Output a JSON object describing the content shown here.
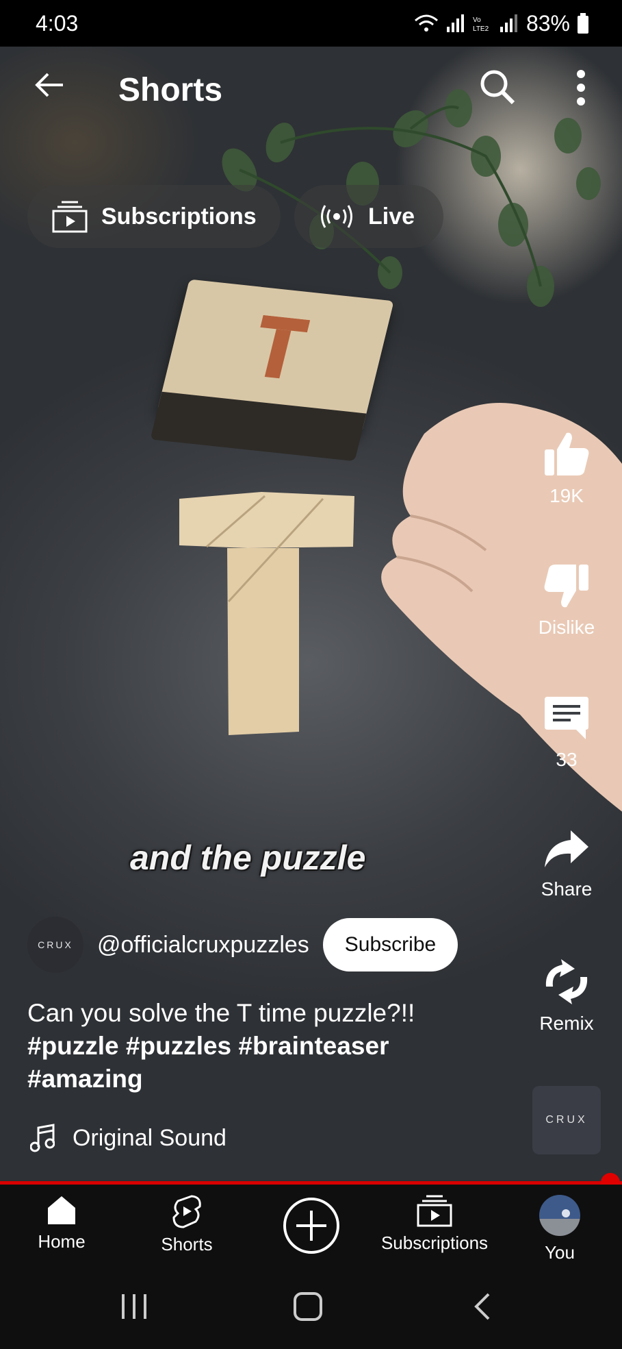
{
  "status_bar": {
    "time": "4:03",
    "battery": "83%"
  },
  "header": {
    "title": "Shorts"
  },
  "chips": [
    {
      "label": "Subscriptions"
    },
    {
      "label": "Live"
    }
  ],
  "video": {
    "caption": "and the puzzle"
  },
  "actions": {
    "like_count": "19K",
    "dislike_label": "Dislike",
    "comment_count": "33",
    "share_label": "Share",
    "remix_label": "Remix"
  },
  "channel": {
    "avatar_text": "CRUX",
    "handle": "@officialcruxpuzzles",
    "subscribe_label": "Subscribe"
  },
  "description": {
    "text": "Can you solve the T time puzzle?!!",
    "hashtags": "#puzzle #puzzles #brainteaser #amazing"
  },
  "sound": {
    "label": "Original Sound",
    "thumb_text": "CRUX"
  },
  "bottom_nav": [
    {
      "label": "Home"
    },
    {
      "label": "Shorts"
    },
    {
      "label": "Subscriptions"
    },
    {
      "label": "You"
    }
  ],
  "colors": {
    "progress": "#d90000",
    "subscribe_bg": "#ffffff",
    "nav_bg": "#0f0f0f"
  }
}
